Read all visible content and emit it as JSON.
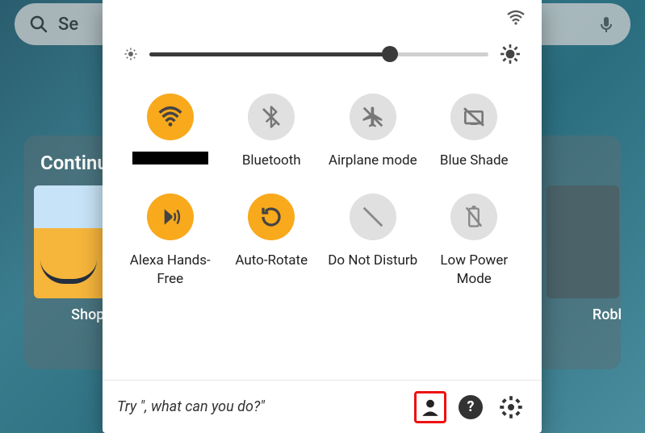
{
  "search": {
    "placeholder": "Se"
  },
  "continue_section": {
    "title": "Continu",
    "apps": [
      {
        "label": "Shop A"
      },
      {
        "label": "Robl"
      }
    ]
  },
  "brightness": {
    "value_percent": 71
  },
  "toggles": [
    {
      "id": "wifi",
      "label_redacted": true,
      "state": "on",
      "icon": "wifi"
    },
    {
      "id": "bluetooth",
      "label": "Bluetooth",
      "state": "off",
      "icon": "bluetooth-off"
    },
    {
      "id": "airplane",
      "label": "Airplane mode",
      "state": "off",
      "icon": "airplane-off"
    },
    {
      "id": "blueshade",
      "label": "Blue Shade",
      "state": "off",
      "icon": "blueshade-off"
    },
    {
      "id": "alexa",
      "label": "Alexa Hands-Free",
      "state": "on",
      "icon": "alexa"
    },
    {
      "id": "autorotate",
      "label": "Auto-Rotate",
      "state": "on",
      "icon": "rotate"
    },
    {
      "id": "dnd",
      "label": "Do Not Disturb",
      "state": "off",
      "icon": "dnd-off"
    },
    {
      "id": "lowpower",
      "label": "Low Power Mode",
      "state": "off",
      "icon": "battery-off"
    }
  ],
  "footer": {
    "prompt": "Try \", what can you do?\""
  },
  "colors": {
    "accent": "#f8a91c",
    "toggle_off": "#e0e0e0",
    "highlight": "#e11"
  }
}
